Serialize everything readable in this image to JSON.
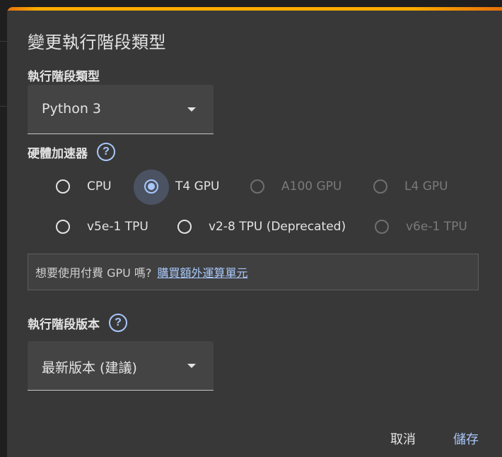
{
  "dialog": {
    "title": "變更執行階段類型",
    "accent_colors": [
      "#e8710a",
      "#f9ab00"
    ]
  },
  "runtime_type": {
    "label": "執行階段類型",
    "value": "Python 3"
  },
  "hardware_accelerator": {
    "label": "硬體加速器",
    "help_icon": "help-circle-icon",
    "options": [
      {
        "label": "CPU",
        "selected": false,
        "enabled": true
      },
      {
        "label": "T4 GPU",
        "selected": true,
        "enabled": true
      },
      {
        "label": "A100 GPU",
        "selected": false,
        "enabled": false
      },
      {
        "label": "L4 GPU",
        "selected": false,
        "enabled": false
      },
      {
        "label": "v5e-1 TPU",
        "selected": false,
        "enabled": true
      },
      {
        "label": "v2-8 TPU (Deprecated)",
        "selected": false,
        "enabled": true
      },
      {
        "label": "v6e-1 TPU",
        "selected": false,
        "enabled": false
      }
    ]
  },
  "info": {
    "text": "想要使用付費 GPU 嗎?",
    "link": "購買額外運算單元"
  },
  "runtime_version": {
    "label": "執行階段版本",
    "help_icon": "help-circle-icon",
    "value": "最新版本 (建議)"
  },
  "actions": {
    "cancel": "取消",
    "save": "儲存"
  },
  "colors": {
    "primary": "#a8c7fa",
    "surface": "#383838",
    "text": "#e3e3e3"
  }
}
